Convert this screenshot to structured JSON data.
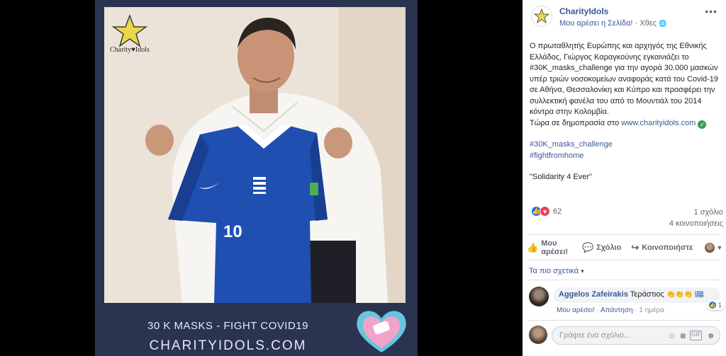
{
  "post_image": {
    "logo_text": "Charity♥Idols",
    "jersey_number": "10",
    "caption_line1": "30 K MASKS  - FIGHT COVID19",
    "caption_line2": "CHARITYIDOLS.COM"
  },
  "header": {
    "page_name": "CharityIdols",
    "like_page_label": "Μου αρέσει η Σελίδα!",
    "separator": "·",
    "timestamp": "Χθες",
    "privacy_icon": "globe-icon",
    "more_label": "•••"
  },
  "post": {
    "text": "Ο πρωταθλητής Ευρώπης και αρχηγός της Εθνικής Ελλάδος, Γιώργος Καραγκούνης εγκαινιάζει το #30K_masks_challenge για την αγορά 30.000 μασκών υπέρ τριών νοσοκομείων αναφοράς κατά του Covid-19 σε Αθήνα, Θεσσαλονίκη και Κύπρο και προσφέρει την συλλεκτική φανέλα του από το Μουντιάλ του 2014 κόντρα στην Κολομβία.",
    "auction_prefix": "Τώρα σε δημοπρασία στο ",
    "auction_link": "www.charityidols.com",
    "hashtag1": "#30K_masks_challenge",
    "hashtag2": "#fightfromhome",
    "quote": "\"Solidarity 4 Ever\""
  },
  "stats": {
    "reaction_count": "62",
    "comments": "1 σχόλιο",
    "shares": "4 κοινοποιήσεις"
  },
  "actions": {
    "like": "Μου αρέσει!",
    "comment": "Σχόλιο",
    "share": "Κοινοποιήστε"
  },
  "sort": {
    "label": "Τα πιο σχετικά",
    "arrow": "▾"
  },
  "comment": {
    "author": "Aggelos Zafeirakis",
    "text": "Τεράστιος",
    "reaction_count": "1",
    "like": "Μου αρέσει!",
    "reply": "Απάντηση",
    "time": "1 ημέρα"
  },
  "composer": {
    "placeholder": "Γράψτε ένα σχόλιο..."
  },
  "colors": {
    "link": "#385898",
    "frame": "#2a3350",
    "jersey": "#1f4fb0",
    "like_blue": "#1877f2",
    "love_red": "#f33e58",
    "check_green": "#31a24c"
  }
}
